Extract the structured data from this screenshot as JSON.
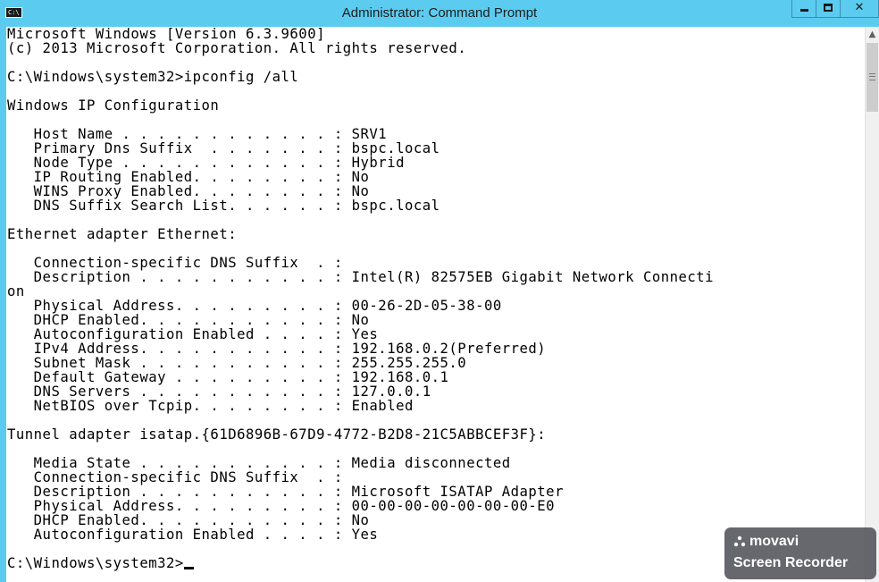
{
  "window": {
    "title": "Administrator: Command Prompt",
    "icon_label": "C:\\",
    "buttons": {
      "minimize": "minimize-icon",
      "maximize": "maximize-icon",
      "close": "close-icon",
      "close_glyph": "✕"
    }
  },
  "console": {
    "lines": [
      "Microsoft Windows [Version 6.3.9600]",
      "(c) 2013 Microsoft Corporation. All rights reserved.",
      "",
      "C:\\Windows\\system32>ipconfig /all",
      "",
      "Windows IP Configuration",
      "",
      "   Host Name . . . . . . . . . . . . : SRV1",
      "   Primary Dns Suffix  . . . . . . . : bspc.local",
      "   Node Type . . . . . . . . . . . . : Hybrid",
      "   IP Routing Enabled. . . . . . . . : No",
      "   WINS Proxy Enabled. . . . . . . . : No",
      "   DNS Suffix Search List. . . . . . : bspc.local",
      "",
      "Ethernet adapter Ethernet:",
      "",
      "   Connection-specific DNS Suffix  . :",
      "   Description . . . . . . . . . . . : Intel(R) 82575EB Gigabit Network Connecti",
      "on",
      "   Physical Address. . . . . . . . . : 00-26-2D-05-38-00",
      "   DHCP Enabled. . . . . . . . . . . : No",
      "   Autoconfiguration Enabled . . . . : Yes",
      "   IPv4 Address. . . . . . . . . . . : 192.168.0.2(Preferred)",
      "   Subnet Mask . . . . . . . . . . . : 255.255.255.0",
      "   Default Gateway . . . . . . . . . : 192.168.0.1",
      "   DNS Servers . . . . . . . . . . . : 127.0.0.1",
      "   NetBIOS over Tcpip. . . . . . . . : Enabled",
      "",
      "Tunnel adapter isatap.{61D6896B-67D9-4772-B2D8-21C5ABBCEF3F}:",
      "",
      "   Media State . . . . . . . . . . . : Media disconnected",
      "   Connection-specific DNS Suffix  . :",
      "   Description . . . . . . . . . . . : Microsoft ISATAP Adapter",
      "   Physical Address. . . . . . . . . : 00-00-00-00-00-00-00-E0",
      "   DHCP Enabled. . . . . . . . . . . : No",
      "   Autoconfiguration Enabled . . . . : Yes",
      ""
    ],
    "prompt": "C:\\Windows\\system32>"
  },
  "scrollbar": {
    "up_glyph": "▲"
  },
  "watermark": {
    "brand": "movavi",
    "product": "Screen Recorder"
  },
  "colors": {
    "titlebar": "#5ccbf0",
    "console_bg": "#ffffff",
    "console_text": "#000000"
  }
}
